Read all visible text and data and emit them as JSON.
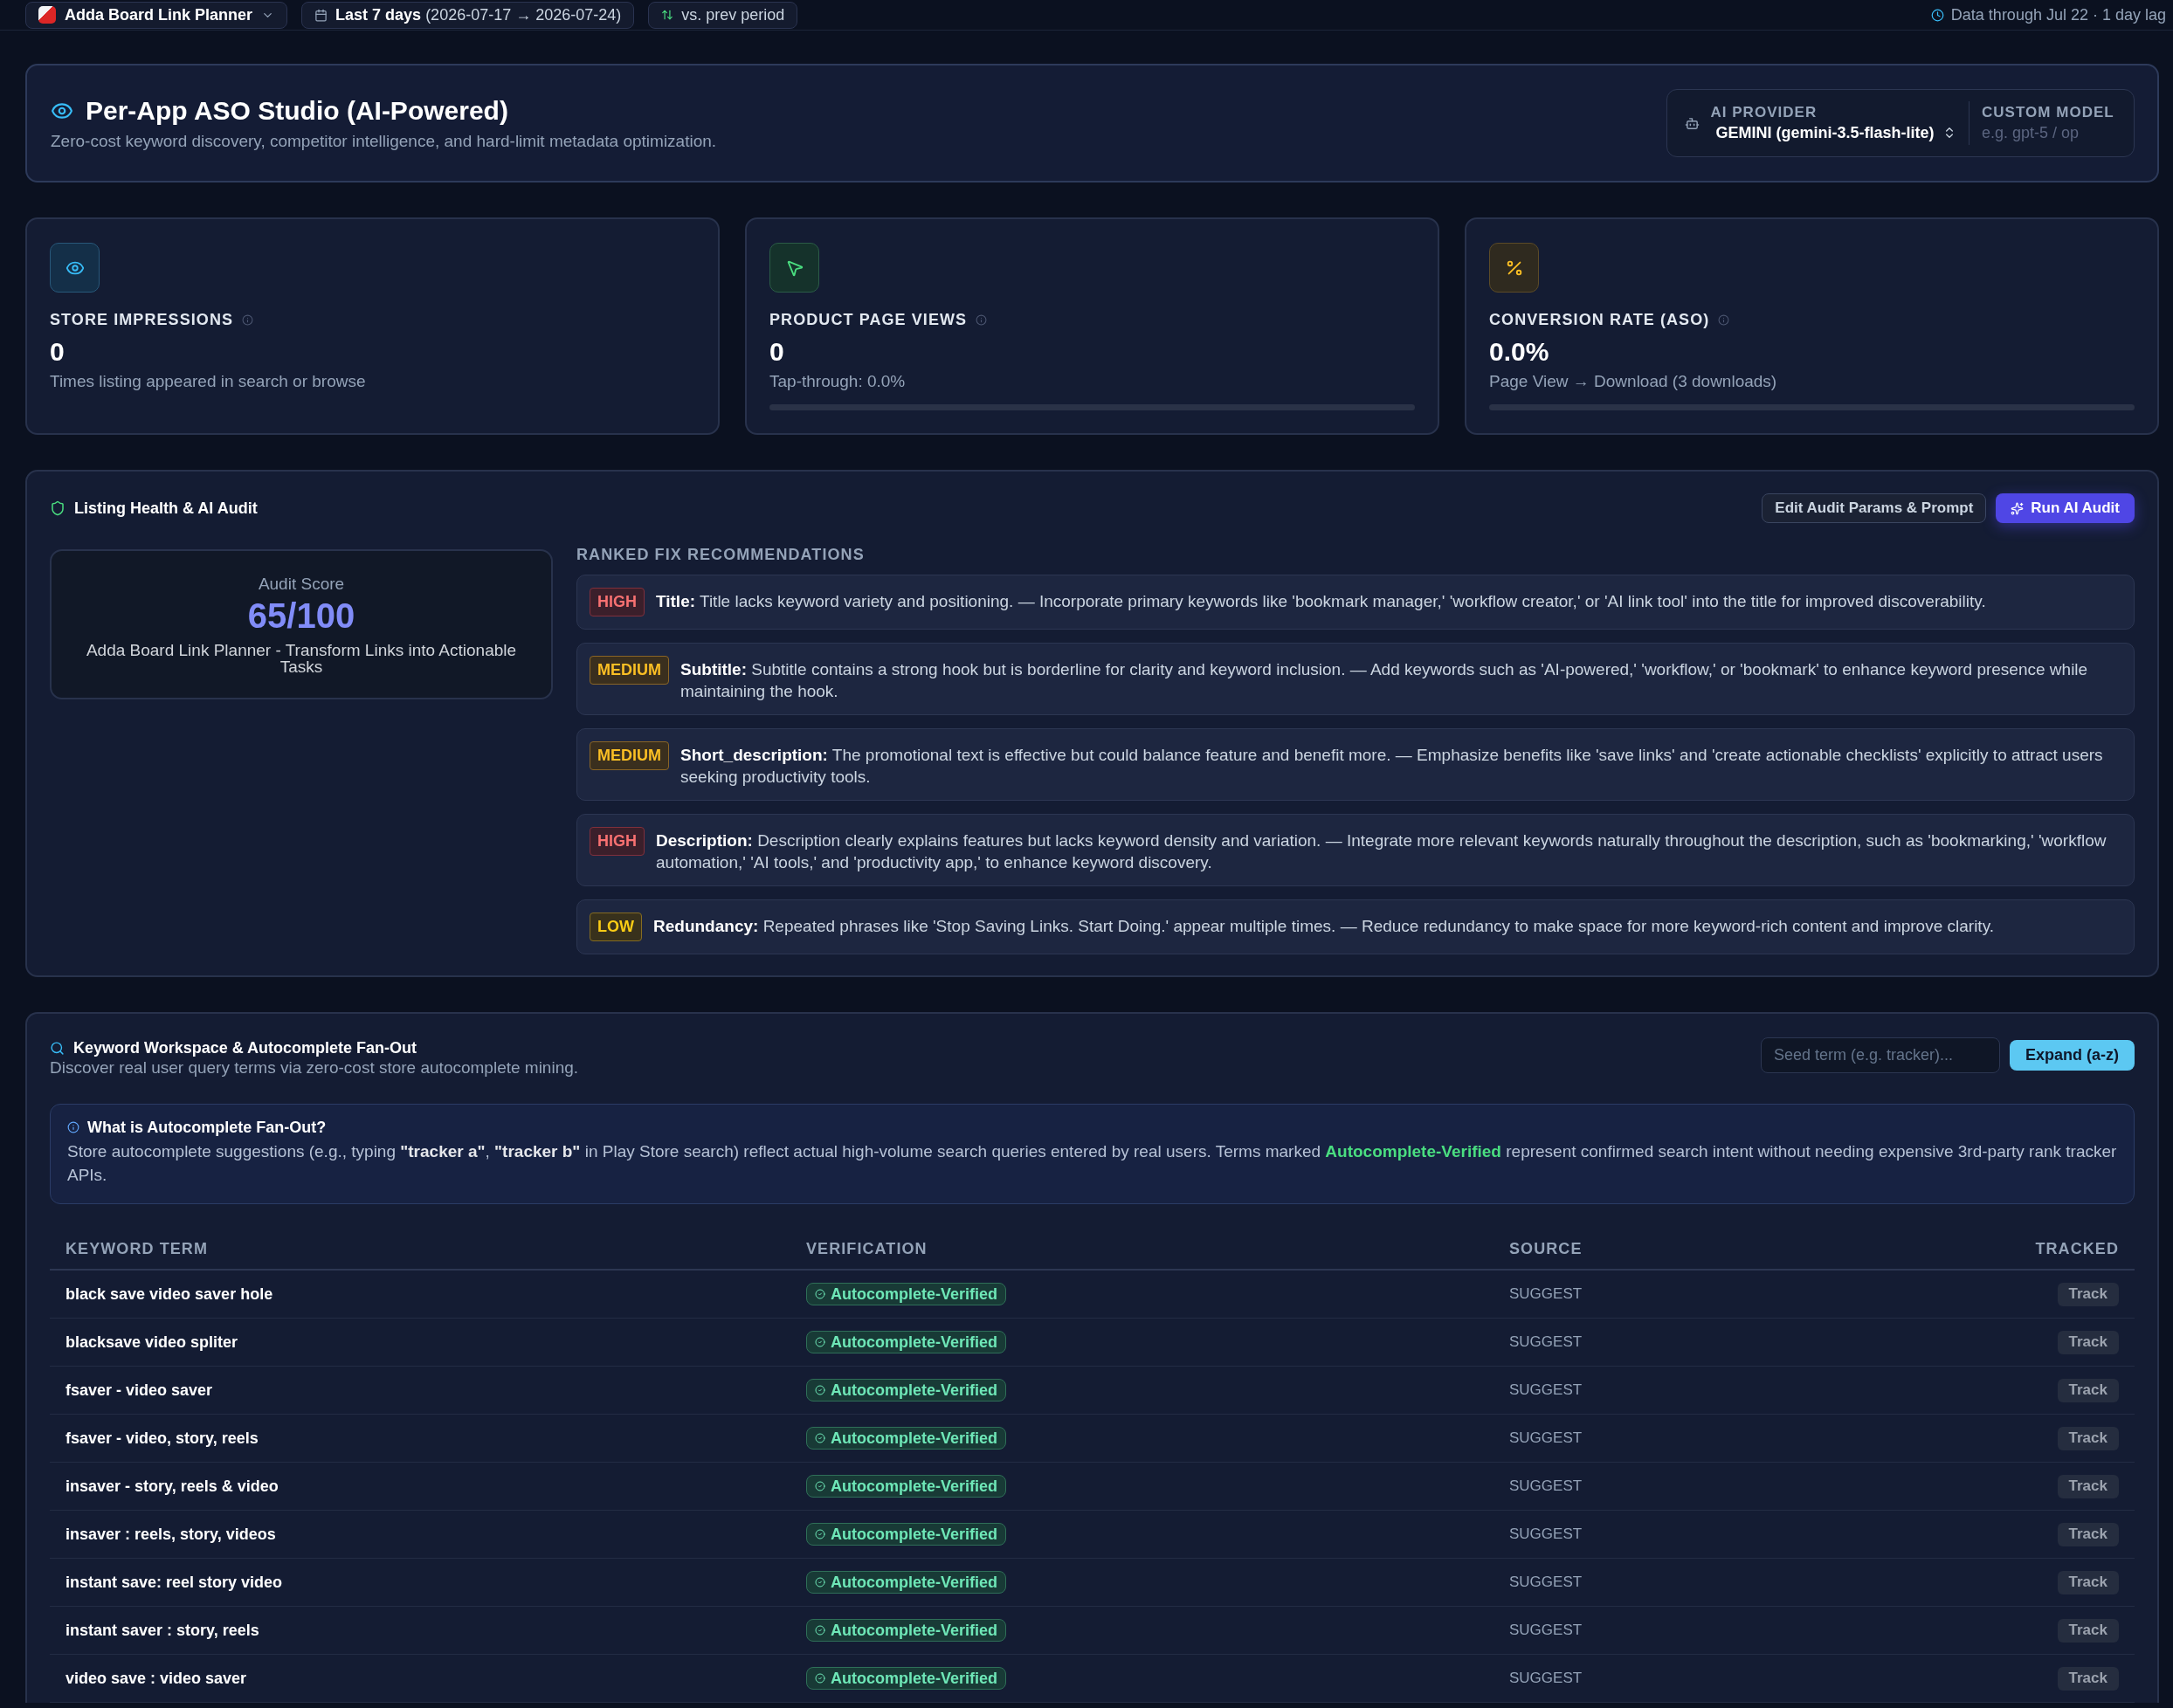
{
  "top_bar": {
    "app": "Adda Board Link Planner",
    "date_range": {
      "label": "Last 7 days",
      "range": "(2026-07-17 → 2026-07-24)"
    },
    "comparison": "vs. prev period",
    "data_status": "Data through Jul 22 · 1 day lag"
  },
  "header": {
    "title": "Per-App ASO Studio (AI-Powered)",
    "subtitle": "Zero-cost keyword discovery, competitor intelligence, and hard-limit metadata optimization.",
    "ai_provider": {
      "label": "AI PROVIDER",
      "value": "GEMINI (gemini-3.5-flash-lite)"
    },
    "custom_model": {
      "label": "CUSTOM MODEL",
      "placeholder": "e.g. gpt-5 / op"
    }
  },
  "stats": [
    {
      "kind": "impressions",
      "label": "STORE IMPRESSIONS",
      "value": "0",
      "caption": "Times listing appeared in search or browse"
    },
    {
      "kind": "views",
      "label": "PRODUCT PAGE VIEWS",
      "value": "0",
      "caption": "Tap-through: 0.0%"
    },
    {
      "kind": "conversion",
      "label": "CONVERSION RATE (ASO)",
      "value": "0.0%",
      "caption": "Page View → Download (3 downloads)"
    }
  ],
  "audit": {
    "title": "Listing Health & AI Audit",
    "buttons": [
      {
        "kind": "secondary",
        "label": "Edit Audit Params & Prompt"
      },
      {
        "kind": "primary",
        "label": "Run AI Audit"
      }
    ],
    "score_card": {
      "label": "Audit Score",
      "score": "65/100",
      "app_name": "Adda Board Link Planner - Transform Links into Actionable Tasks"
    },
    "recommendations_heading": "RANKED FIX RECOMMENDATIONS",
    "recommendations": [
      {
        "kind": "high",
        "badge": "HIGH",
        "text": "**Title:** Title lacks keyword variety and positioning. — Incorporate primary keywords like 'bookmark manager,' 'workflow creator,' or 'AI link tool' into the title for improved discoverability."
      },
      {
        "kind": "medium",
        "badge": "MEDIUM",
        "text": "**Subtitle:** Subtitle contains a strong hook but is borderline for clarity and keyword inclusion. — Add keywords such as 'AI-powered,' 'workflow,' or 'bookmark' to enhance keyword presence while maintaining the hook."
      },
      {
        "kind": "medium",
        "badge": "MEDIUM",
        "text": "**Short_description:** The promotional text is effective but could balance feature and benefit more. — Emphasize benefits like 'save links' and 'create actionable checklists' explicitly to attract users seeking productivity tools."
      },
      {
        "kind": "high",
        "badge": "HIGH",
        "text": "**Description:** Description clearly explains features but lacks keyword density and variation. — Integrate more relevant keywords naturally throughout the description, such as 'bookmarking,' 'workflow automation,' 'AI tools,' and 'productivity app,' to enhance keyword discovery."
      },
      {
        "kind": "low",
        "badge": "LOW",
        "text": "**Redundancy:** Repeated phrases like 'Stop Saving Links. Start Doing.' appear multiple times. — Reduce redundancy to make space for more keyword-rich content and improve clarity."
      }
    ]
  },
  "keywords": {
    "title": "Keyword Workspace & Autocomplete Fan-Out",
    "subtitle": "Discover real user query terms via zero-cost store autocomplete mining.",
    "seed_field": {
      "placeholder": "Seed term (e.g. tracker)..."
    },
    "expand_button": "Expand (a-z)",
    "info": {
      "title": "What is Autocomplete Fan-Out?",
      "body": [
        {
          "kind": "plain",
          "text": "Store autocomplete suggestions (e.g., typing "
        },
        {
          "kind": "bold",
          "text": "\"tracker a\""
        },
        {
          "kind": "plain",
          "text": ", "
        },
        {
          "kind": "bold",
          "text": "\"tracker b\""
        },
        {
          "kind": "plain",
          "text": " in Play Store search) reflect actual high-volume search queries entered by real users. Terms marked "
        },
        {
          "kind": "highlight",
          "text": "Autocomplete-Verified"
        },
        {
          "kind": "plain",
          "text": " represent confirmed search intent without needing expensive 3rd-party rank tracker APIs."
        }
      ]
    },
    "table": {
      "columns": [
        "KEYWORD TERM",
        "VERIFICATION",
        "SOURCE",
        "TRACKED"
      ],
      "rows": [
        {
          "term": "black save video saver hole",
          "verification": "Autocomplete-Verified",
          "source": "SUGGEST",
          "action": "Track"
        },
        {
          "term": "blacksave video spliter",
          "verification": "Autocomplete-Verified",
          "source": "SUGGEST",
          "action": "Track"
        },
        {
          "term": "fsaver - video saver",
          "verification": "Autocomplete-Verified",
          "source": "SUGGEST",
          "action": "Track"
        },
        {
          "term": "fsaver - video, story, reels",
          "verification": "Autocomplete-Verified",
          "source": "SUGGEST",
          "action": "Track"
        },
        {
          "term": "insaver - story, reels & video",
          "verification": "Autocomplete-Verified",
          "source": "SUGGEST",
          "action": "Track"
        },
        {
          "term": "insaver : reels, story, videos",
          "verification": "Autocomplete-Verified",
          "source": "SUGGEST",
          "action": "Track"
        },
        {
          "term": "instant save: reel story video",
          "verification": "Autocomplete-Verified",
          "source": "SUGGEST",
          "action": "Track"
        },
        {
          "term": "instant saver : story, reels",
          "verification": "Autocomplete-Verified",
          "source": "SUGGEST",
          "action": "Track"
        },
        {
          "term": "video save : video saver",
          "verification": "Autocomplete-Verified",
          "source": "SUGGEST",
          "action": "Track"
        }
      ]
    }
  }
}
